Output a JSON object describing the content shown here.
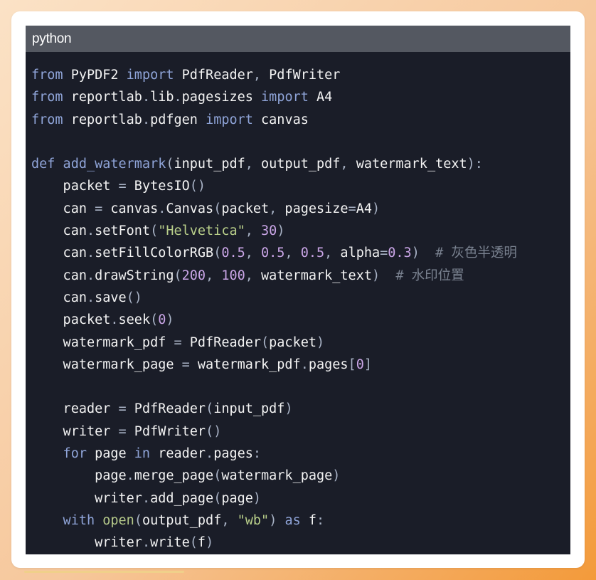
{
  "code_block": {
    "language": "python",
    "lines": [
      [
        {
          "t": "from",
          "c": "kw"
        },
        {
          "t": " ",
          "c": "id"
        },
        {
          "t": "PyPDF2",
          "c": "id"
        },
        {
          "t": " ",
          "c": "id"
        },
        {
          "t": "import",
          "c": "kw"
        },
        {
          "t": " PdfReader",
          "c": "id"
        },
        {
          "t": ",",
          "c": "p"
        },
        {
          "t": " PdfWriter",
          "c": "id"
        }
      ],
      [
        {
          "t": "from",
          "c": "kw"
        },
        {
          "t": " reportlab",
          "c": "id"
        },
        {
          "t": ".",
          "c": "p"
        },
        {
          "t": "lib",
          "c": "id"
        },
        {
          "t": ".",
          "c": "p"
        },
        {
          "t": "pagesizes ",
          "c": "id"
        },
        {
          "t": "import",
          "c": "kw"
        },
        {
          "t": " A4",
          "c": "id"
        }
      ],
      [
        {
          "t": "from",
          "c": "kw"
        },
        {
          "t": " reportlab",
          "c": "id"
        },
        {
          "t": ".",
          "c": "p"
        },
        {
          "t": "pdfgen ",
          "c": "id"
        },
        {
          "t": "import",
          "c": "kw"
        },
        {
          "t": " canvas",
          "c": "id"
        }
      ],
      [],
      [
        {
          "t": "def",
          "c": "kw"
        },
        {
          "t": " add_watermark",
          "c": "kw"
        },
        {
          "t": "(",
          "c": "p"
        },
        {
          "t": "input_pdf",
          "c": "id"
        },
        {
          "t": ",",
          "c": "p"
        },
        {
          "t": " output_pdf",
          "c": "id"
        },
        {
          "t": ",",
          "c": "p"
        },
        {
          "t": " watermark_text",
          "c": "id"
        },
        {
          "t": "):",
          "c": "p"
        }
      ],
      [
        {
          "t": "    packet ",
          "c": "id"
        },
        {
          "t": "=",
          "c": "p"
        },
        {
          "t": " BytesIO",
          "c": "id"
        },
        {
          "t": "()",
          "c": "p"
        }
      ],
      [
        {
          "t": "    can ",
          "c": "id"
        },
        {
          "t": "=",
          "c": "p"
        },
        {
          "t": " canvas",
          "c": "id"
        },
        {
          "t": ".",
          "c": "p"
        },
        {
          "t": "Canvas",
          "c": "id"
        },
        {
          "t": "(",
          "c": "p"
        },
        {
          "t": "packet",
          "c": "id"
        },
        {
          "t": ",",
          "c": "p"
        },
        {
          "t": " pagesize",
          "c": "id"
        },
        {
          "t": "=",
          "c": "p"
        },
        {
          "t": "A4",
          "c": "id"
        },
        {
          "t": ")",
          "c": "p"
        }
      ],
      [
        {
          "t": "    can",
          "c": "id"
        },
        {
          "t": ".",
          "c": "p"
        },
        {
          "t": "setFont",
          "c": "id"
        },
        {
          "t": "(",
          "c": "p"
        },
        {
          "t": "\"Helvetica\"",
          "c": "str"
        },
        {
          "t": ",",
          "c": "p"
        },
        {
          "t": " 30",
          "c": "num"
        },
        {
          "t": ")",
          "c": "p"
        }
      ],
      [
        {
          "t": "    can",
          "c": "id"
        },
        {
          "t": ".",
          "c": "p"
        },
        {
          "t": "setFillColorRGB",
          "c": "id"
        },
        {
          "t": "(",
          "c": "p"
        },
        {
          "t": "0.5",
          "c": "num"
        },
        {
          "t": ",",
          "c": "p"
        },
        {
          "t": " 0.5",
          "c": "num"
        },
        {
          "t": ",",
          "c": "p"
        },
        {
          "t": " 0.5",
          "c": "num"
        },
        {
          "t": ",",
          "c": "p"
        },
        {
          "t": " alpha",
          "c": "id"
        },
        {
          "t": "=",
          "c": "p"
        },
        {
          "t": "0.3",
          "c": "num"
        },
        {
          "t": ")",
          "c": "p"
        },
        {
          "t": "  # 灰色半透明",
          "c": "cm"
        }
      ],
      [
        {
          "t": "    can",
          "c": "id"
        },
        {
          "t": ".",
          "c": "p"
        },
        {
          "t": "drawString",
          "c": "id"
        },
        {
          "t": "(",
          "c": "p"
        },
        {
          "t": "200",
          "c": "num"
        },
        {
          "t": ",",
          "c": "p"
        },
        {
          "t": " 100",
          "c": "num"
        },
        {
          "t": ",",
          "c": "p"
        },
        {
          "t": " watermark_text",
          "c": "id"
        },
        {
          "t": ")",
          "c": "p"
        },
        {
          "t": "  # 水印位置",
          "c": "cm"
        }
      ],
      [
        {
          "t": "    can",
          "c": "id"
        },
        {
          "t": ".",
          "c": "p"
        },
        {
          "t": "save",
          "c": "id"
        },
        {
          "t": "()",
          "c": "p"
        }
      ],
      [
        {
          "t": "    packet",
          "c": "id"
        },
        {
          "t": ".",
          "c": "p"
        },
        {
          "t": "seek",
          "c": "id"
        },
        {
          "t": "(",
          "c": "p"
        },
        {
          "t": "0",
          "c": "num"
        },
        {
          "t": ")",
          "c": "p"
        }
      ],
      [
        {
          "t": "    watermark_pdf ",
          "c": "id"
        },
        {
          "t": "=",
          "c": "p"
        },
        {
          "t": " PdfReader",
          "c": "id"
        },
        {
          "t": "(",
          "c": "p"
        },
        {
          "t": "packet",
          "c": "id"
        },
        {
          "t": ")",
          "c": "p"
        }
      ],
      [
        {
          "t": "    watermark_page ",
          "c": "id"
        },
        {
          "t": "=",
          "c": "p"
        },
        {
          "t": " watermark_pdf",
          "c": "id"
        },
        {
          "t": ".",
          "c": "p"
        },
        {
          "t": "pages",
          "c": "id"
        },
        {
          "t": "[",
          "c": "p"
        },
        {
          "t": "0",
          "c": "num"
        },
        {
          "t": "]",
          "c": "p"
        }
      ],
      [],
      [
        {
          "t": "    reader ",
          "c": "id"
        },
        {
          "t": "=",
          "c": "p"
        },
        {
          "t": " PdfReader",
          "c": "id"
        },
        {
          "t": "(",
          "c": "p"
        },
        {
          "t": "input_pdf",
          "c": "id"
        },
        {
          "t": ")",
          "c": "p"
        }
      ],
      [
        {
          "t": "    writer ",
          "c": "id"
        },
        {
          "t": "=",
          "c": "p"
        },
        {
          "t": " PdfWriter",
          "c": "id"
        },
        {
          "t": "()",
          "c": "p"
        }
      ],
      [
        {
          "t": "    for",
          "c": "kw"
        },
        {
          "t": " page ",
          "c": "id"
        },
        {
          "t": "in",
          "c": "kw"
        },
        {
          "t": " reader",
          "c": "id"
        },
        {
          "t": ".",
          "c": "p"
        },
        {
          "t": "pages",
          "c": "id"
        },
        {
          "t": ":",
          "c": "p"
        }
      ],
      [
        {
          "t": "        page",
          "c": "id"
        },
        {
          "t": ".",
          "c": "p"
        },
        {
          "t": "merge_page",
          "c": "id"
        },
        {
          "t": "(",
          "c": "p"
        },
        {
          "t": "watermark_page",
          "c": "id"
        },
        {
          "t": ")",
          "c": "p"
        }
      ],
      [
        {
          "t": "        writer",
          "c": "id"
        },
        {
          "t": ".",
          "c": "p"
        },
        {
          "t": "add_page",
          "c": "id"
        },
        {
          "t": "(",
          "c": "p"
        },
        {
          "t": "page",
          "c": "id"
        },
        {
          "t": ")",
          "c": "p"
        }
      ],
      [
        {
          "t": "    with",
          "c": "kw"
        },
        {
          "t": " open",
          "c": "bi"
        },
        {
          "t": "(",
          "c": "p"
        },
        {
          "t": "output_pdf",
          "c": "id"
        },
        {
          "t": ",",
          "c": "p"
        },
        {
          "t": " ",
          "c": "id"
        },
        {
          "t": "\"wb\"",
          "c": "str"
        },
        {
          "t": ")",
          "c": "p"
        },
        {
          "t": " as",
          "c": "kw"
        },
        {
          "t": " f",
          "c": "id"
        },
        {
          "t": ":",
          "c": "p"
        }
      ],
      [
        {
          "t": "        writer",
          "c": "id"
        },
        {
          "t": ".",
          "c": "p"
        },
        {
          "t": "write",
          "c": "id"
        },
        {
          "t": "(",
          "c": "p"
        },
        {
          "t": "f",
          "c": "id"
        },
        {
          "t": ")",
          "c": "p"
        }
      ]
    ]
  }
}
